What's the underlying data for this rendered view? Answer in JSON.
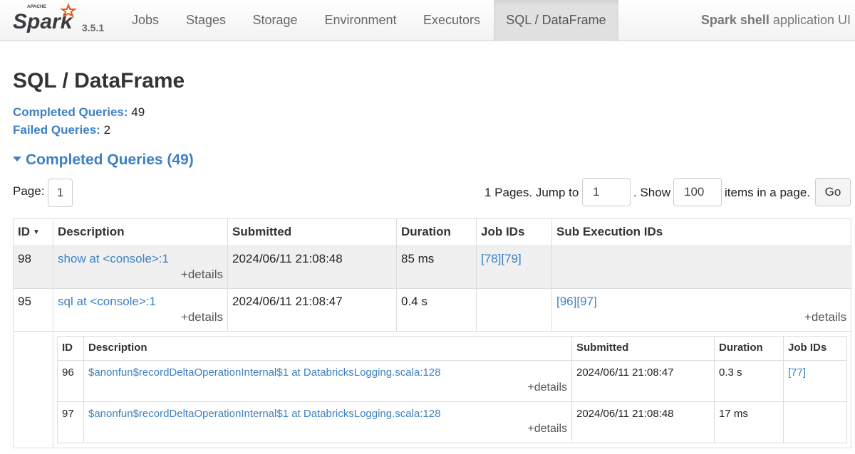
{
  "navbar": {
    "logo_alt": "Apache Spark",
    "logo_small_text": "APACHE",
    "logo_text": "Spark",
    "version": "3.5.1",
    "tabs": [
      {
        "label": "Jobs"
      },
      {
        "label": "Stages"
      },
      {
        "label": "Storage"
      },
      {
        "label": "Environment"
      },
      {
        "label": "Executors"
      },
      {
        "label": "SQL / DataFrame",
        "active": true
      }
    ],
    "app_name": "Spark shell",
    "app_suffix": " application UI"
  },
  "page": {
    "title": "SQL / DataFrame",
    "completed_label": "Completed Queries:",
    "completed_value": "49",
    "failed_label": "Failed Queries:",
    "failed_value": "2",
    "section_title": "Completed Queries (49)"
  },
  "pagination": {
    "page_label": "Page:",
    "current_page": "1",
    "pages_text": "1 Pages. Jump to",
    "jump_value": "1",
    "show_text": ". Show",
    "show_value": "100",
    "items_text": "items in a page.",
    "go_label": "Go"
  },
  "table": {
    "headers": [
      "ID",
      "Description",
      "Submitted",
      "Duration",
      "Job IDs",
      "Sub Execution IDs"
    ],
    "sort_indicator": "▼",
    "rows": [
      {
        "id": "98",
        "description": "show at <console>:1",
        "details": "+details",
        "submitted": "2024/06/11 21:08:48",
        "duration": "85 ms",
        "job_ids": "[78][79]",
        "sub_exec_ids": "",
        "sub_details": ""
      },
      {
        "id": "95",
        "description": "sql at <console>:1",
        "details": "+details",
        "submitted": "2024/06/11 21:08:47",
        "duration": "0.4 s",
        "job_ids": "",
        "sub_exec_ids": "[96][97]",
        "sub_details": "+details"
      }
    ]
  },
  "sub_table": {
    "headers": [
      "ID",
      "Description",
      "Submitted",
      "Duration",
      "Job IDs"
    ],
    "rows": [
      {
        "id": "96",
        "description": "$anonfun$recordDeltaOperationInternal$1 at DatabricksLogging.scala:128",
        "details": "+details",
        "submitted": "2024/06/11 21:08:47",
        "duration": "0.3 s",
        "job_ids": "[77]"
      },
      {
        "id": "97",
        "description": "$anonfun$recordDeltaOperationInternal$1 at DatabricksLogging.scala:128",
        "details": "+details",
        "submitted": "2024/06/11 21:08:48",
        "duration": "17 ms",
        "job_ids": ""
      }
    ]
  },
  "colors": {
    "link": "#3d81c4",
    "logo_orange": "#e25a1c",
    "logo_dark": "#3c3a3e"
  }
}
